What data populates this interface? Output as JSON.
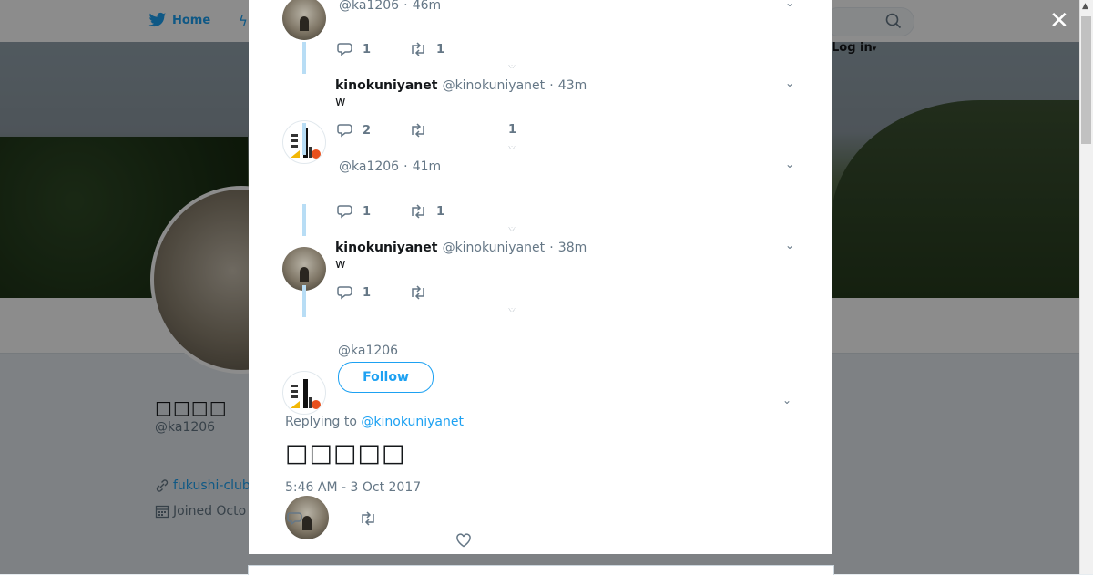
{
  "nav": {
    "home_label": "Home",
    "login_label": "Log in"
  },
  "profile": {
    "display_name": "□□□□",
    "handle": "@ka1206",
    "url_text": "fukushi-club",
    "joined_text": "Joined Octo"
  },
  "thread": [
    {
      "name": "",
      "handle": "@ka1206",
      "time": "46m",
      "text": "",
      "replies": "1",
      "retweets": "1",
      "likes": ""
    },
    {
      "name": "kinokuniyanet",
      "handle": "@kinokuniyanet",
      "time": "43m",
      "text": "w",
      "replies": "2",
      "retweets": "",
      "likes": "1"
    },
    {
      "name": "",
      "handle": "@ka1206",
      "time": "41m",
      "text": "",
      "replies": "1",
      "retweets": "1",
      "likes": ""
    },
    {
      "name": "kinokuniyanet",
      "handle": "@kinokuniyanet",
      "time": "38m",
      "text": "w",
      "replies": "1",
      "retweets": "",
      "likes": ""
    }
  ],
  "focused": {
    "handle": "@ka1206",
    "follow_label": "Follow",
    "replying_prefix": "Replying to",
    "replying_to": "@kinokuniyanet",
    "text": "□□□□□",
    "timestamp": "5:46 AM - 3 Oct 2017"
  },
  "colors": {
    "accent": "#1da1f2",
    "thread_line": "#b8ddf5",
    "muted": "#657786"
  }
}
